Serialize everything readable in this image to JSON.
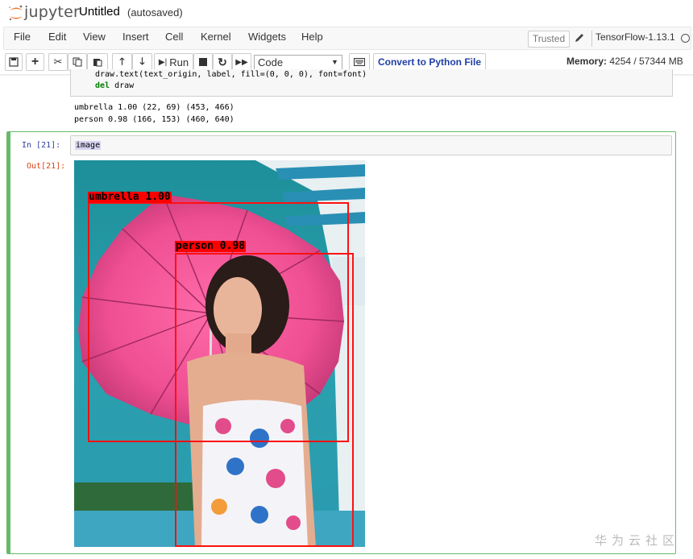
{
  "header": {
    "brand": "jupyter",
    "notebook_name": "Untitled",
    "save_status": "(autosaved)"
  },
  "menubar": {
    "items": [
      "File",
      "Edit",
      "View",
      "Insert",
      "Cell",
      "Kernel",
      "Widgets",
      "Help"
    ],
    "trusted_label": "Trusted",
    "kernel_name": "TensorFlow-1.13.1"
  },
  "toolbar": {
    "run_label": "Run",
    "cell_type": "Code",
    "convert_label": "Convert to Python File",
    "memory_label": "Memory:",
    "memory_value": "4254 / 57344 MB"
  },
  "previous_cell": {
    "code_line_1": "draw.text(text_origin, label, fill=(0, 0, 0), font=font)",
    "code_line_2_kw": "del",
    "code_line_2_rest": " draw",
    "output_lines": [
      "umbrella 1.00 (22, 69) (453, 466)",
      "person 0.98 (166, 153) (460, 640)"
    ]
  },
  "active_cell": {
    "in_prompt": "In  [21]:",
    "code": "image",
    "out_prompt": "Out[21]:"
  },
  "detections": [
    {
      "label": "umbrella 1.00",
      "class": "umbrella",
      "score": 1.0
    },
    {
      "label": "person 0.98",
      "class": "person",
      "score": 0.98
    }
  ],
  "watermark": "华为云社区",
  "colors": {
    "bbox": "#ff0000",
    "selected_cell_border": "#66bb6a",
    "in_prompt": "#303f9f",
    "out_prompt": "#d84315",
    "convert_button_text": "#1f3ea6"
  }
}
